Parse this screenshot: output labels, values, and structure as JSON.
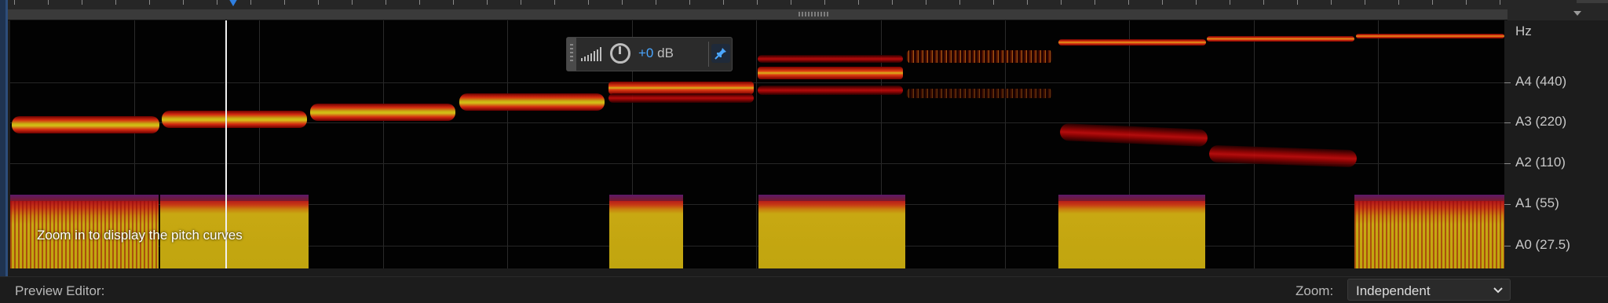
{
  "pitch_display": {
    "overlay_message": "Zoom in to display the pitch curves",
    "axis_unit": "Hz",
    "axis_labels": [
      "A4 (440)",
      "A3 (220)",
      "A2 (110)",
      "A1 (55)",
      "A0 (27.5)"
    ]
  },
  "hud": {
    "gain_number": "+0",
    "gain_unit": " dB",
    "icons": [
      "volume-meter-icon",
      "gain-knob-icon",
      "pin-icon"
    ]
  },
  "footer": {
    "preview_editor_label": "Preview Editor:",
    "zoom_label": "Zoom:",
    "zoom_value": "Independent"
  },
  "colors": {
    "playhead_marker": "#2f7fe0",
    "gain_value": "#4aa6ff",
    "spectrum_background": "#020202"
  }
}
